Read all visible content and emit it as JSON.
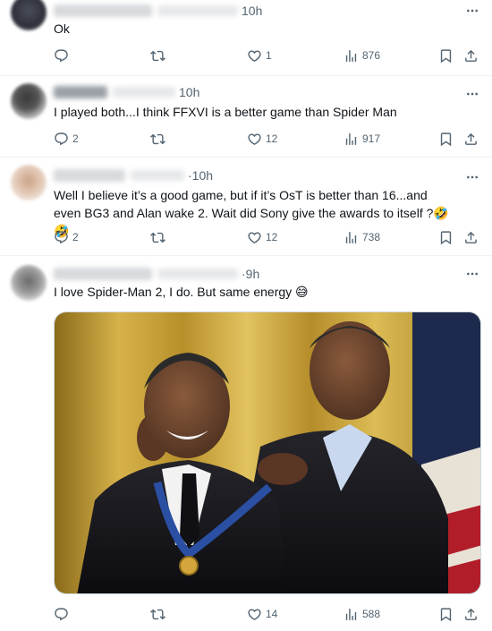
{
  "tweets": [
    {
      "time": "10h",
      "text": "Ok",
      "replies": "",
      "likes": "1",
      "views": "876"
    },
    {
      "time": "10h",
      "text": "I played both...I think FFXVI is a better game than Spider Man",
      "replies": "2",
      "likes": "12",
      "views": "917"
    },
    {
      "time": "·10h",
      "text": "Well I believe it’s a good game, but if it’s OsT is better than 16...and even BG3 and Alan wake 2. Wait did Sony give the awards to itself ?🤣🤣",
      "replies": "2",
      "likes": "12",
      "views": "738"
    },
    {
      "time": "·9h",
      "text": "I love Spider-Man 2, I do.  But same energy 😅",
      "replies": "",
      "likes": "14",
      "views": "588"
    }
  ],
  "icons": {
    "reply": "reply-icon",
    "retweet": "retweet-icon",
    "like": "heart-icon",
    "views": "views-icon",
    "bookmark": "bookmark-icon",
    "share": "share-icon",
    "more": "more-icon"
  },
  "colors": {
    "text": "#0f1419",
    "muted": "#536471",
    "divider": "#eff3f4",
    "photo_backdrop": "#c9a227"
  }
}
